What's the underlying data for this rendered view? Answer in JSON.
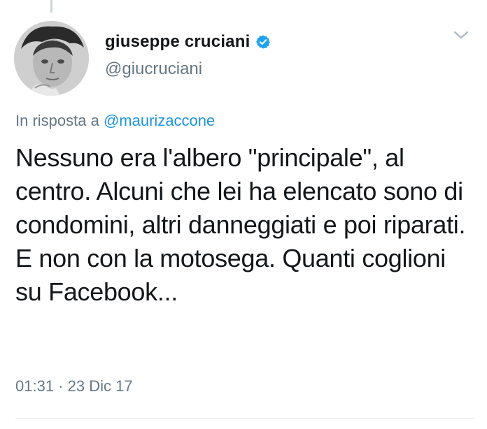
{
  "author": {
    "display_name": "giuseppe cruciani",
    "handle": "@giucruciani",
    "verified": true,
    "avatar_icon": "avatar-photo"
  },
  "reply": {
    "prefix": "In risposta a",
    "mention": "@maurizaccone"
  },
  "tweet": {
    "text": "Nessuno era l'albero \"principale\", al centro. Alcuni che lei ha elencato sono di condomini, altri danneggiati e poi riparati. E non con la motosega. Quanti coglioni su Facebook...",
    "time": "01:31",
    "separator": "·",
    "date": "23 Dic 17"
  },
  "colors": {
    "link": "#1b95e0",
    "secondary_text": "#657786",
    "verified_badge": "#1da1f2"
  },
  "icons": {
    "verified": "verified-badge-icon",
    "menu": "chevron-down-icon"
  }
}
